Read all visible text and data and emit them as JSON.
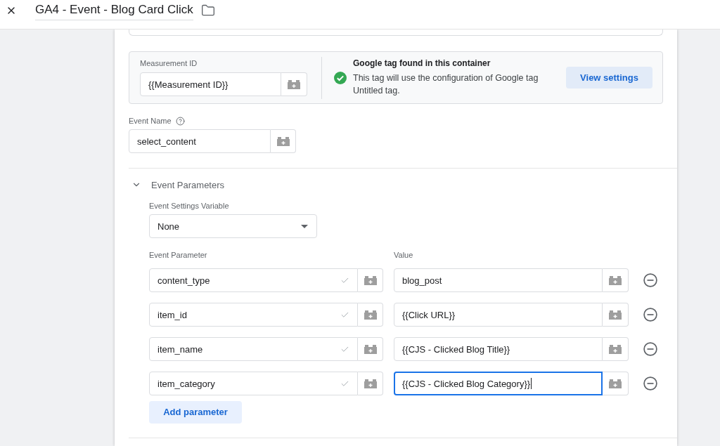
{
  "header": {
    "title": "GA4 - Event - Blog Card Click"
  },
  "google_tag": {
    "measurement_label": "Measurement ID",
    "measurement_value": "{{Measurement ID}}",
    "status_title": "Google tag found in this container",
    "status_text": "This tag will use the configuration of Google tag Untitled tag.",
    "button": "View settings"
  },
  "event_name": {
    "label": "Event Name",
    "value": "select_content"
  },
  "event_parameters": {
    "title": "Event Parameters",
    "expanded": true,
    "settings_label": "Event Settings Variable",
    "settings_value": "None",
    "columns": [
      "Event Parameter",
      "Value"
    ],
    "rows": [
      {
        "parameter": "content_type",
        "valid": true,
        "value": "blog_post",
        "focused": false
      },
      {
        "parameter": "item_id",
        "valid": true,
        "value": "{{Click URL}}",
        "focused": false
      },
      {
        "parameter": "item_name",
        "valid": true,
        "value": "{{CJS - Clicked Blog Title}}",
        "focused": false
      },
      {
        "parameter": "item_category",
        "valid": true,
        "value": "{{CJS - Clicked Blog Category}}",
        "focused": true
      }
    ],
    "add_button": "Add parameter"
  }
}
